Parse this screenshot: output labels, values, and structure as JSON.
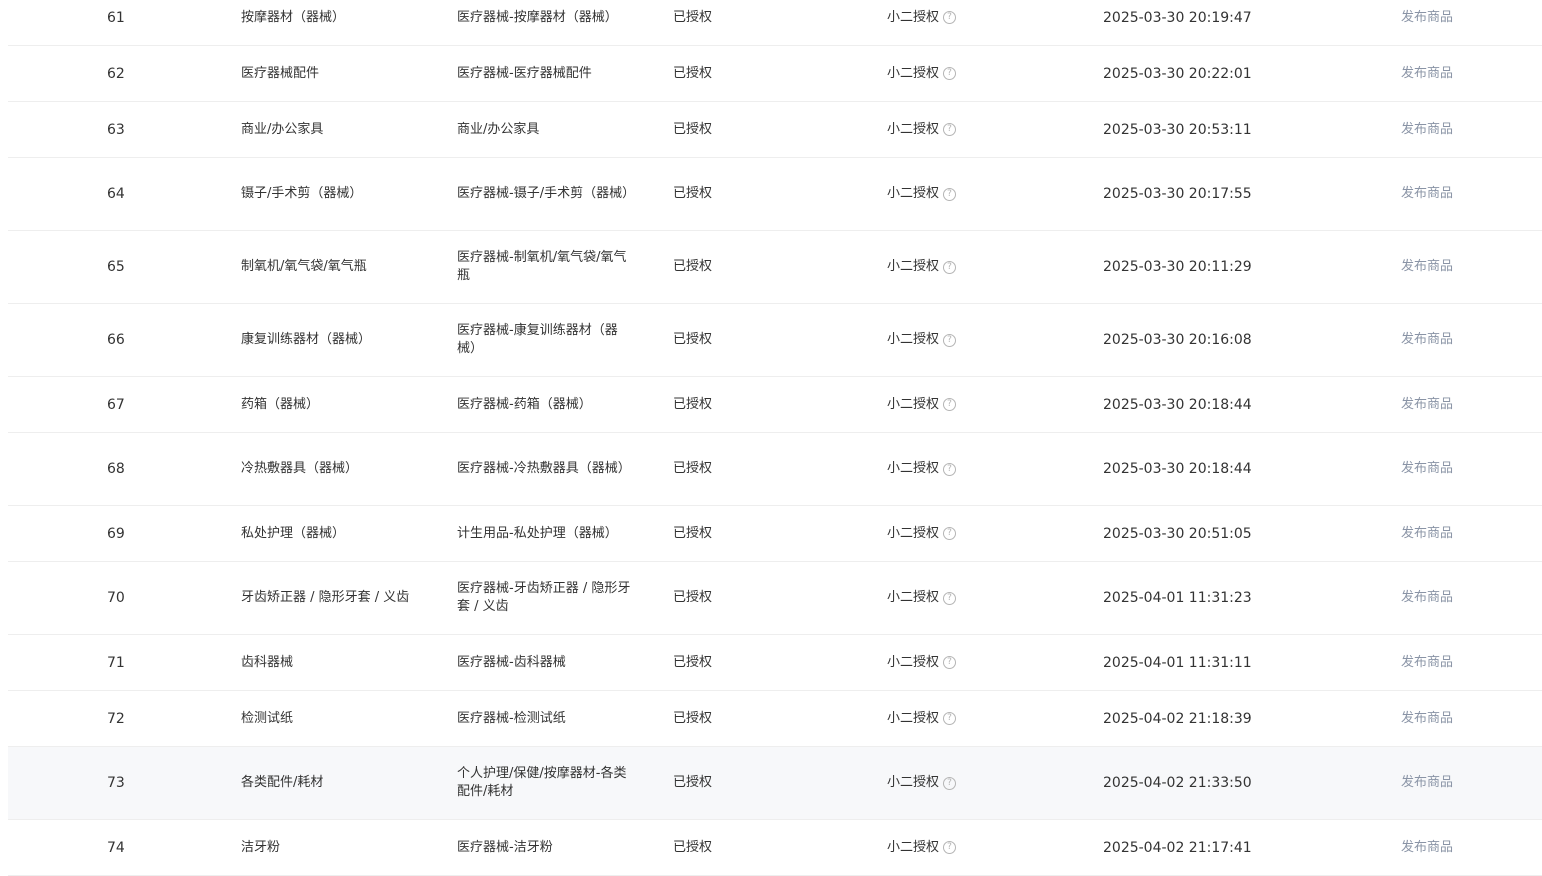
{
  "ui": {
    "help_glyph": "?"
  },
  "rows": [
    {
      "index": "61",
      "name": "按摩器材（器械）",
      "path": "医疗器械-按摩器材（器械）",
      "status": "已授权",
      "auth": "小二授权",
      "time": "2025-03-30 20:19:47",
      "action": "发布商品"
    },
    {
      "index": "62",
      "name": "医疗器械配件",
      "path": "医疗器械-医疗器械配件",
      "status": "已授权",
      "auth": "小二授权",
      "time": "2025-03-30 20:22:01",
      "action": "发布商品"
    },
    {
      "index": "63",
      "name": "商业/办公家具",
      "path": "商业/办公家具",
      "status": "已授权",
      "auth": "小二授权",
      "time": "2025-03-30 20:53:11",
      "action": "发布商品"
    },
    {
      "index": "64",
      "name": "镊子/手术剪（器械）",
      "path": "医疗器械-镊子/手术剪（器械）",
      "status": "已授权",
      "auth": "小二授权",
      "time": "2025-03-30 20:17:55",
      "action": "发布商品"
    },
    {
      "index": "65",
      "name": "制氧机/氧气袋/氧气瓶",
      "path": "医疗器械-制氧机/氧气袋/氧气瓶",
      "status": "已授权",
      "auth": "小二授权",
      "time": "2025-03-30 20:11:29",
      "action": "发布商品"
    },
    {
      "index": "66",
      "name": "康复训练器材（器械）",
      "path": "医疗器械-康复训练器材（器械）",
      "status": "已授权",
      "auth": "小二授权",
      "time": "2025-03-30 20:16:08",
      "action": "发布商品"
    },
    {
      "index": "67",
      "name": "药箱（器械）",
      "path": "医疗器械-药箱（器械）",
      "status": "已授权",
      "auth": "小二授权",
      "time": "2025-03-30 20:18:44",
      "action": "发布商品"
    },
    {
      "index": "68",
      "name": "冷热敷器具（器械）",
      "path": "医疗器械-冷热敷器具（器械）",
      "status": "已授权",
      "auth": "小二授权",
      "time": "2025-03-30 20:18:44",
      "action": "发布商品"
    },
    {
      "index": "69",
      "name": "私处护理（器械）",
      "path": "计生用品-私处护理（器械）",
      "status": "已授权",
      "auth": "小二授权",
      "time": "2025-03-30 20:51:05",
      "action": "发布商品"
    },
    {
      "index": "70",
      "name": "牙齿矫正器 / 隐形牙套 / 义齿",
      "path": "医疗器械-牙齿矫正器 / 隐形牙套 / 义齿",
      "status": "已授权",
      "auth": "小二授权",
      "time": "2025-04-01 11:31:23",
      "action": "发布商品"
    },
    {
      "index": "71",
      "name": "齿科器械",
      "path": "医疗器械-齿科器械",
      "status": "已授权",
      "auth": "小二授权",
      "time": "2025-04-01 11:31:11",
      "action": "发布商品"
    },
    {
      "index": "72",
      "name": "检测试纸",
      "path": "医疗器械-检测试纸",
      "status": "已授权",
      "auth": "小二授权",
      "time": "2025-04-02 21:18:39",
      "action": "发布商品"
    },
    {
      "index": "73",
      "name": "各类配件/耗材",
      "path": "个人护理/保健/按摩器材-各类配件/耗材",
      "status": "已授权",
      "auth": "小二授权",
      "time": "2025-04-02 21:33:50",
      "action": "发布商品"
    },
    {
      "index": "74",
      "name": "洁牙粉",
      "path": "医疗器械-洁牙粉",
      "status": "已授权",
      "auth": "小二授权",
      "time": "2025-04-02 21:17:41",
      "action": "发布商品"
    }
  ]
}
